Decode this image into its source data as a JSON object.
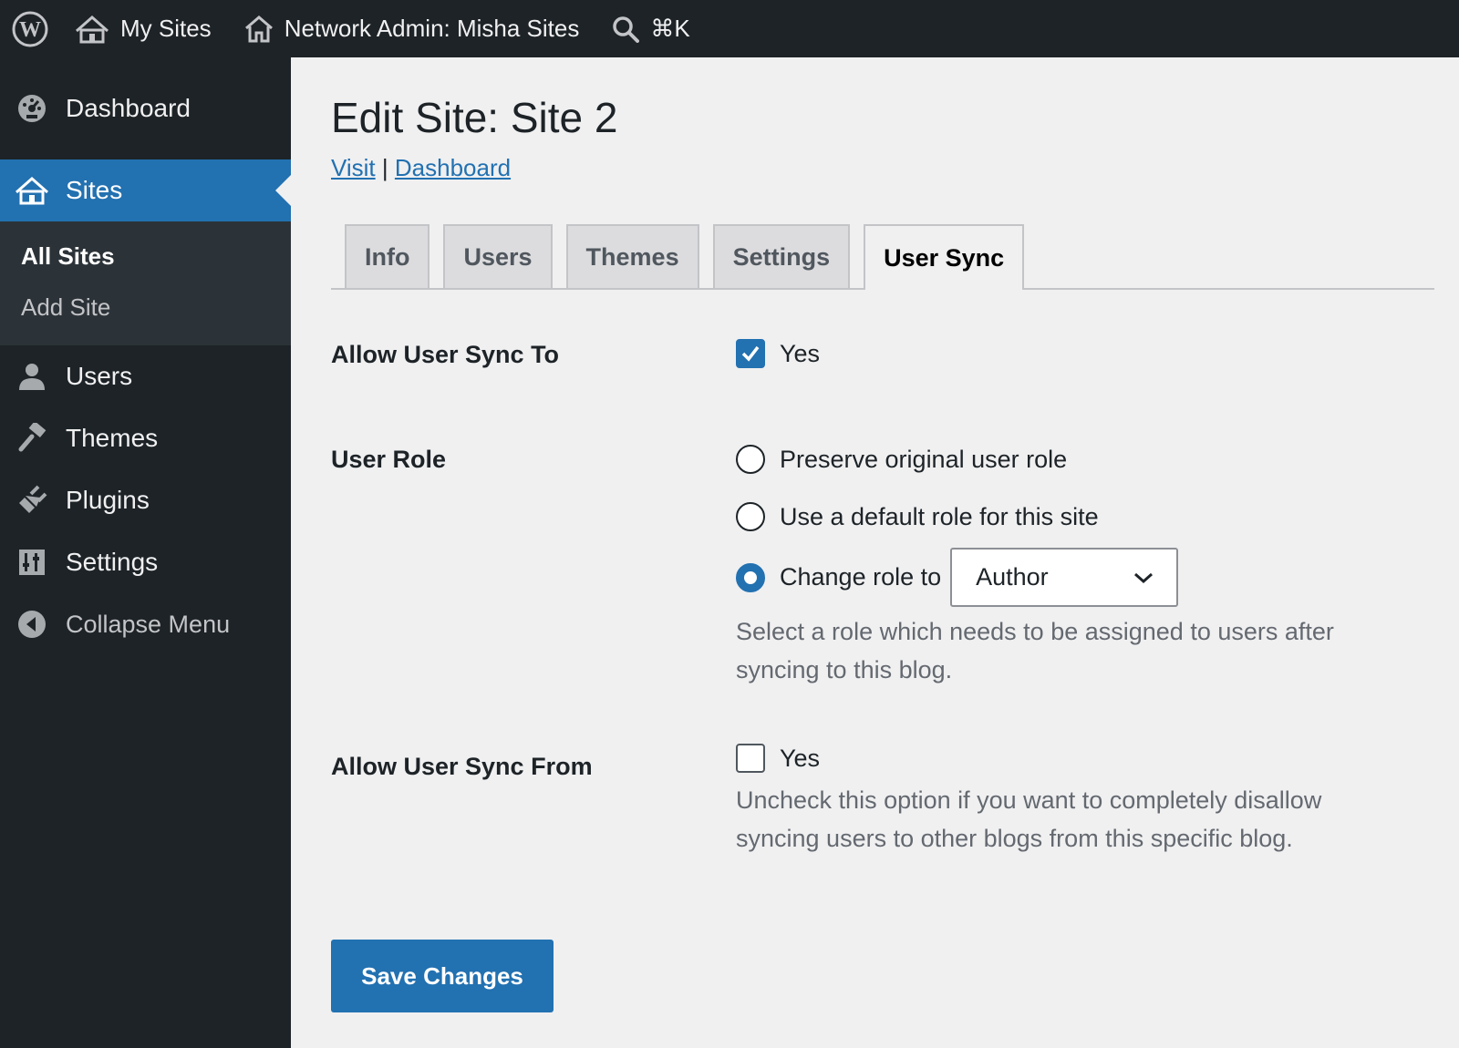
{
  "adminbar": {
    "my_sites": "My Sites",
    "network_admin": "Network Admin: Misha Sites",
    "search_shortcut": "⌘K"
  },
  "sidebar": {
    "dashboard": "Dashboard",
    "sites": "Sites",
    "sites_sub": {
      "all_sites": "All Sites",
      "add_site": "Add Site"
    },
    "users": "Users",
    "themes": "Themes",
    "plugins": "Plugins",
    "settings": "Settings",
    "collapse": "Collapse Menu"
  },
  "page": {
    "title": "Edit Site: Site 2",
    "visit_link": "Visit",
    "separator": "|",
    "dashboard_link": "Dashboard"
  },
  "tabs": {
    "info": "Info",
    "users": "Users",
    "themes": "Themes",
    "settings": "Settings",
    "user_sync": "User Sync",
    "active": "User Sync"
  },
  "form": {
    "allow_sync_to": {
      "label": "Allow User Sync To",
      "option": "Yes",
      "checked": true
    },
    "user_role": {
      "label": "User Role",
      "preserve": "Preserve original user role",
      "default_role": "Use a default role for this site",
      "change_role": "Change role to",
      "selected_option": "change_role",
      "role_value": "Author",
      "description": "Select a role which needs to be assigned to users after syncing to this blog."
    },
    "allow_sync_from": {
      "label": "Allow User Sync From",
      "option": "Yes",
      "checked": false,
      "description": "Uncheck this option if you want to completely disallow syncing users to other blogs from this specific blog."
    },
    "save_button": "Save Changes"
  },
  "colors": {
    "admin_dark": "#1d2327",
    "accent_blue": "#2271b1",
    "page_bg": "#f0f0f1",
    "submenu_bg": "#2c3338"
  }
}
